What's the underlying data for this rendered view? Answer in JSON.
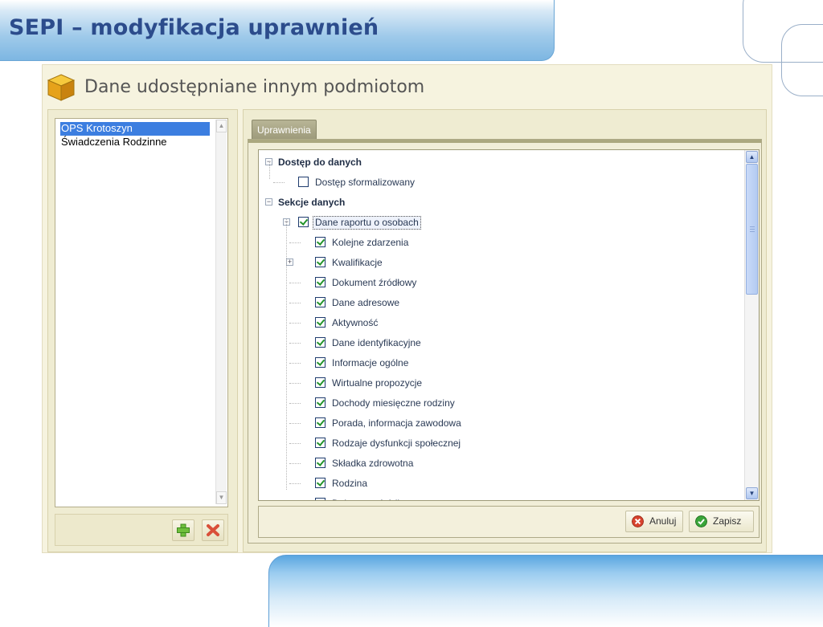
{
  "slide": {
    "title": "SEPI – modyfikacja uprawnień"
  },
  "window": {
    "title": "Dane udostępniane innym podmiotom",
    "icon": "cube-icon"
  },
  "left_list": {
    "items": [
      {
        "label": "OPS Krotoszyn",
        "selected": true
      },
      {
        "label": "Świadczenia Rodzinne",
        "selected": false
      }
    ]
  },
  "left_actions": {
    "add_icon": "plus-icon",
    "delete_icon": "delete-x-icon"
  },
  "tabs": [
    {
      "label": "Uprawnienia",
      "active": true
    }
  ],
  "tree": {
    "nodes": [
      {
        "label": "Dostęp do danych",
        "level": 0,
        "expander": "minus",
        "bold": true
      },
      {
        "label": "Dostęp sformalizowany",
        "level": 1,
        "checked": false
      },
      {
        "label": "Sekcje danych",
        "level": 0,
        "expander": "minus",
        "bold": true
      },
      {
        "label": "Dane raportu o osobach",
        "level": 1,
        "expander": "minus",
        "checked": true,
        "selected": true
      },
      {
        "label": "Kolejne zdarzenia",
        "level": 2,
        "checked": true
      },
      {
        "label": "Kwalifikacje",
        "level": 2,
        "expander": "plus",
        "checked": true
      },
      {
        "label": "Dokument źródłowy",
        "level": 2,
        "checked": true
      },
      {
        "label": "Dane adresowe",
        "level": 2,
        "checked": true
      },
      {
        "label": "Aktywność",
        "level": 2,
        "checked": true
      },
      {
        "label": "Dane identyfikacyjne",
        "level": 2,
        "checked": true
      },
      {
        "label": "Informacje ogólne",
        "level": 2,
        "checked": true
      },
      {
        "label": "Wirtualne propozycje",
        "level": 2,
        "checked": true
      },
      {
        "label": "Dochody miesięczne rodziny",
        "level": 2,
        "checked": true
      },
      {
        "label": "Porada, informacja zawodowa",
        "level": 2,
        "checked": true
      },
      {
        "label": "Rodzaje dysfunkcji społecznej",
        "level": 2,
        "checked": true
      },
      {
        "label": "Składka zdrowotna",
        "level": 2,
        "checked": true
      },
      {
        "label": "Rodzina",
        "level": 2,
        "checked": true
      },
      {
        "label": "Dokument źródłowy",
        "level": 2,
        "checked": true
      }
    ]
  },
  "buttons": {
    "cancel": {
      "label": "Anuluj",
      "icon": "cancel-icon",
      "color": "#d8432e"
    },
    "save": {
      "label": "Zapisz",
      "icon": "check-icon",
      "color": "#3aa53a"
    }
  }
}
